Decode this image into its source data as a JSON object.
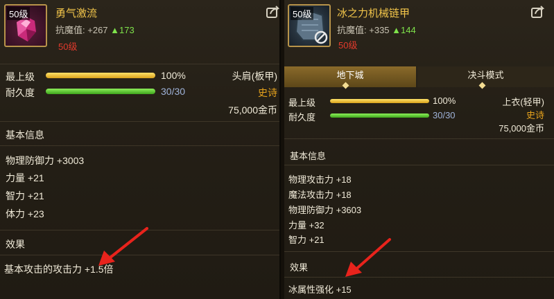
{
  "left": {
    "level_badge": "50级",
    "name": "勇气激流",
    "resist_label": "抗魔值:",
    "resist_value": "+267",
    "resist_up": "▲173",
    "required_level": "50级",
    "bars": [
      {
        "label": "最上级",
        "value": "100%",
        "fill_fraction": 1.0
      },
      {
        "label": "耐久度",
        "value": "30/30",
        "fill_fraction": 1.0
      }
    ],
    "slot": "头肩(板甲)",
    "rarity": "史诗",
    "price": "75,000金币",
    "basic_info_title": "基本信息",
    "stats": [
      "物理防御力 +3003",
      "力量 +21",
      "智力 +21",
      "体力 +23"
    ],
    "effect_title": "效果",
    "effect": "基本攻击的攻击力 +1.5倍"
  },
  "right": {
    "level_badge": "50级",
    "name": "冰之力机械链甲",
    "resist_label": "抗魔值:",
    "resist_value": "+335",
    "resist_up": "▲144",
    "required_level": "50级",
    "tabs": [
      {
        "label": "地下城",
        "active": true
      },
      {
        "label": "决斗模式",
        "active": false
      }
    ],
    "bars": [
      {
        "label": "最上级",
        "value": "100%",
        "fill_fraction": 1.0
      },
      {
        "label": "耐久度",
        "value": "30/30",
        "fill_fraction": 1.0
      }
    ],
    "slot": "上衣(轻甲)",
    "rarity": "史诗",
    "price": "75,000金币",
    "basic_info_title": "基本信息",
    "stats": [
      "物理攻击力 +18",
      "魔法攻击力 +18",
      "物理防御力 +3603",
      "力量 +32",
      "智力 +21"
    ],
    "effect_title": "效果",
    "effect": "冰属性强化 +15"
  },
  "colors": {
    "name_gold": "#f2c54a",
    "rarity_orange": "#e7a31c",
    "required_red": "#e23a2c",
    "up_green": "#7fe24b",
    "arrow_red": "#e8231c"
  },
  "icons": [
    "share-icon",
    "gem-armor-icon",
    "chain-armor-icon",
    "no-icon",
    "red-arrow-icon"
  ]
}
